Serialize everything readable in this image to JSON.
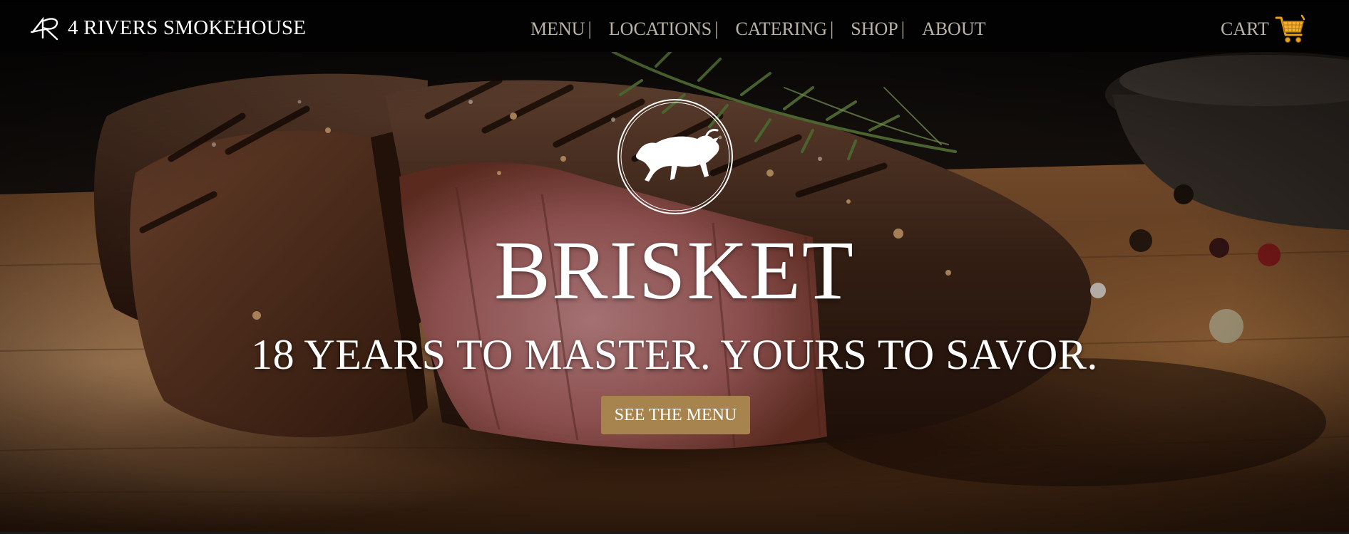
{
  "brand": {
    "name": "4 RIVERS SMOKEHOUSE",
    "logo_icon": "4r-monogram-icon"
  },
  "nav": {
    "items": [
      {
        "label": "MENU",
        "separator": "|"
      },
      {
        "label": "LOCATIONS",
        "separator": "|"
      },
      {
        "label": "CATERING",
        "separator": "|"
      },
      {
        "label": "SHOP",
        "separator": "|"
      },
      {
        "label": "ABOUT",
        "separator": ""
      }
    ]
  },
  "cart": {
    "label": "CART",
    "icon": "shopping-cart-icon",
    "icon_color": "#e8a21c"
  },
  "hero": {
    "emblem_icon": "bull-emblem-icon",
    "title": "BRISKET",
    "subtitle": "18 YEARS TO MASTER. YOURS TO SAVOR.",
    "cta_label": "SEE THE MENU",
    "cta_color": "#a7844e"
  },
  "colors": {
    "navbar_bg": "#020202",
    "nav_text": "#b9b2a6",
    "brand_text": "#ffffff"
  }
}
